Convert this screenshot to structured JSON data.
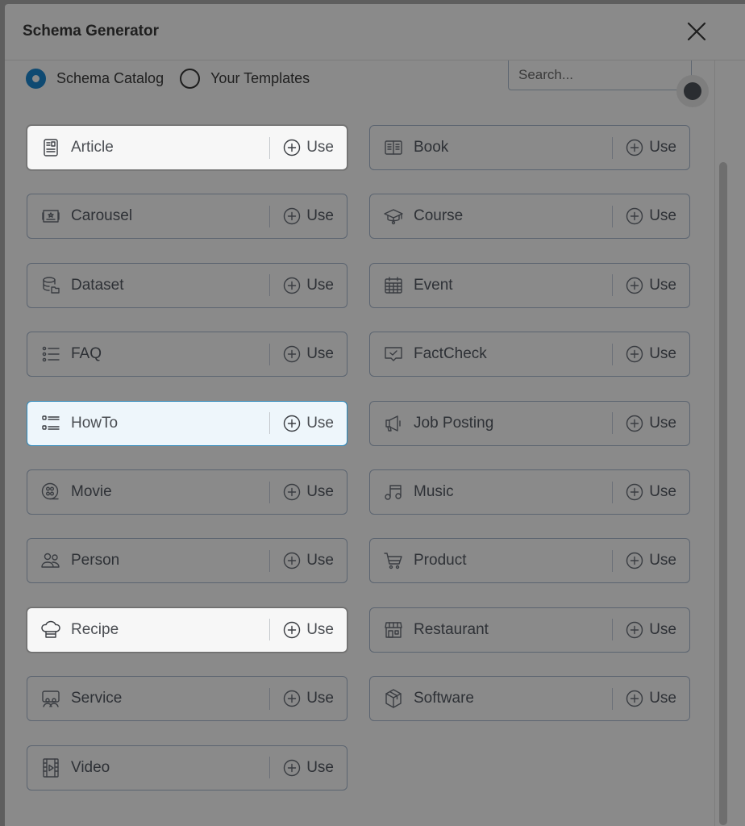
{
  "dialog": {
    "title": "Schema Generator",
    "close_icon": "close-icon"
  },
  "source_options": [
    {
      "label": "Schema Catalog",
      "checked": true
    },
    {
      "label": "Your Templates",
      "checked": false
    }
  ],
  "search": {
    "placeholder": "Search...",
    "value": ""
  },
  "use_label": "Use",
  "schemas": [
    {
      "name": "Article",
      "icon": "article-icon",
      "state": "highlighted"
    },
    {
      "name": "Book",
      "icon": "book-icon",
      "state": "normal"
    },
    {
      "name": "Carousel",
      "icon": "carousel-icon",
      "state": "normal"
    },
    {
      "name": "Course",
      "icon": "graduation-cap-icon",
      "state": "normal"
    },
    {
      "name": "Dataset",
      "icon": "database-icon",
      "state": "normal"
    },
    {
      "name": "Event",
      "icon": "calendar-icon",
      "state": "normal"
    },
    {
      "name": "FAQ",
      "icon": "list-icon",
      "state": "normal"
    },
    {
      "name": "FactCheck",
      "icon": "message-check-icon",
      "state": "normal"
    },
    {
      "name": "HowTo",
      "icon": "checklist-icon",
      "state": "focused"
    },
    {
      "name": "Job Posting",
      "icon": "megaphone-icon",
      "state": "normal"
    },
    {
      "name": "Movie",
      "icon": "film-reel-icon",
      "state": "normal"
    },
    {
      "name": "Music",
      "icon": "music-note-icon",
      "state": "normal"
    },
    {
      "name": "Person",
      "icon": "users-icon",
      "state": "normal"
    },
    {
      "name": "Product",
      "icon": "cart-icon",
      "state": "normal"
    },
    {
      "name": "Recipe",
      "icon": "chef-hat-icon",
      "state": "highlighted"
    },
    {
      "name": "Restaurant",
      "icon": "storefront-icon",
      "state": "normal"
    },
    {
      "name": "Service",
      "icon": "service-icon",
      "state": "normal"
    },
    {
      "name": "Software",
      "icon": "package-icon",
      "state": "normal"
    },
    {
      "name": "Video",
      "icon": "video-film-icon",
      "state": "normal"
    }
  ]
}
